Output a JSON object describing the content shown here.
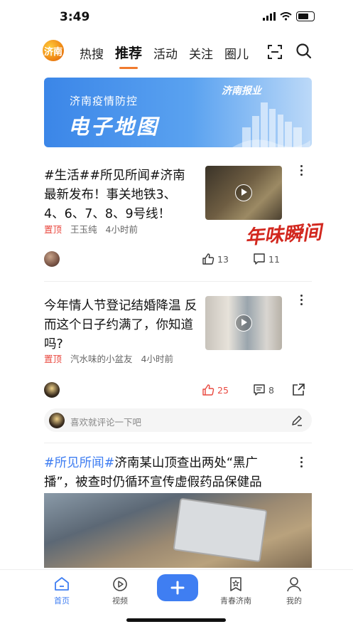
{
  "status": {
    "time": "3:49"
  },
  "header": {
    "logo_text": "济南",
    "tabs": [
      "热搜",
      "推荐",
      "活动",
      "关注",
      "圈儿"
    ],
    "active_tab": 1
  },
  "banner": {
    "subtitle": "济南疫情防控",
    "title": "电子地图",
    "brand": "济南报业"
  },
  "feed": [
    {
      "headline": "#生活##所见所闻#济南最新发布！事关地铁3、4、6、7、8、9号线！",
      "pin": "置顶",
      "author": "王玉纯",
      "time": "4小时前",
      "likes": "13",
      "comments": "11",
      "stamp": "年味瞬间"
    },
    {
      "headline": "今年情人节登记结婚降温 反而这个日子约满了，你知道吗?",
      "pin": "置顶",
      "author": "汽水味的小盆友",
      "time": "4小时前",
      "likes": "25",
      "comments": "8"
    },
    {
      "headline_tag": "#所见所闻#",
      "headline": "济南某山顶查出两处“黑广播”，被查时仍循环宣传虚假药品保健品"
    }
  ],
  "comment_bar": {
    "placeholder": "喜欢就评论一下吧"
  },
  "tabbar": {
    "items": [
      "首页",
      "视频",
      "青春济南",
      "我的"
    ]
  },
  "colors": {
    "accent": "#3f7ef2",
    "active_underline": "#f07a2e",
    "like_active": "#e9483f",
    "pin": "#e9483f"
  }
}
